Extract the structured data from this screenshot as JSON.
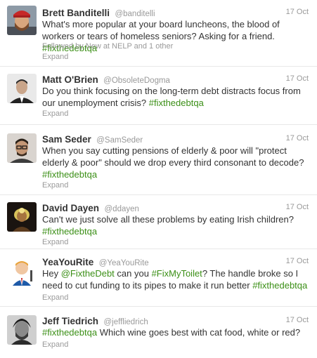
{
  "tweets": [
    {
      "name": "Brett Banditelli",
      "handle": "@banditelli",
      "time": "17 Oct",
      "text_a": "What's more popular at your board luncheons, the blood of workers or tears of homeless seniors? Asking for a friend. ",
      "hashtag": "#fixthedebtqa",
      "followed_by": "Followed by New at NELP and 1 other",
      "expand": "Expand"
    },
    {
      "name": "Matt O'Brien",
      "handle": "@ObsoleteDogma",
      "time": "17 Oct",
      "text_a": "Do you think focusing on the long-term debt distracts focus from our unemployment crisis? ",
      "hashtag": "#fixthedebtqa",
      "expand": "Expand"
    },
    {
      "name": "Sam Seder",
      "handle": "@SamSeder",
      "time": "17 Oct",
      "text_a": "When you say cutting pensions of elderly & poor will \"protect elderly & poor\" should we drop every third consonant to decode?",
      "hashtag": "#fixthedebtqa",
      "expand": "Expand"
    },
    {
      "name": "David Dayen",
      "handle": "@ddayen",
      "time": "17 Oct",
      "text_a": "Can't we just solve all these problems by eating Irish children?",
      "hashtag": "#fixthedebtqa",
      "expand": "Expand"
    },
    {
      "name": "YeaYouRite",
      "handle": "@YeaYouRite",
      "time": "17 Oct",
      "text_a": "Hey ",
      "mention": "@FixtheDebt",
      "text_b": " can you ",
      "hashtag2": "#FixMyToilet",
      "text_c": "? The handle broke so I need to cut funding to its pipes to make it run better ",
      "hashtag": "#fixthedebtqa",
      "expand": "Expand"
    },
    {
      "name": "Jeff Tiedrich",
      "handle": "@jeffliedrich",
      "time": "17 Oct",
      "hashtag": "#fixthedebtqa",
      "text_a": " Which wine goes best with cat food, white or red?",
      "expand": "Expand"
    }
  ]
}
